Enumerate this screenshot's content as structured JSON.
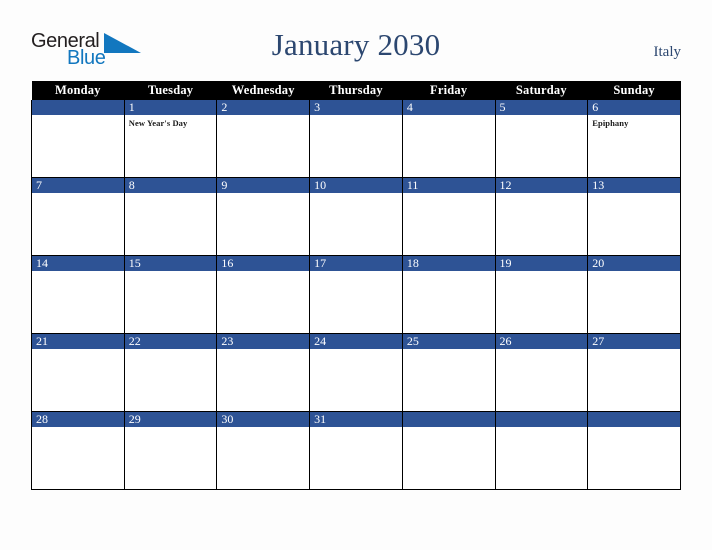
{
  "brand": {
    "name_part1": "General",
    "name_part2": "Blue",
    "triangle_icon": "blue-triangle-icon",
    "color_dark": "#231f20",
    "color_blue": "#1277bf"
  },
  "header": {
    "title": "January 2030",
    "locale": "Italy",
    "title_color": "#2c4770"
  },
  "calendar": {
    "month": "January",
    "year": "2030",
    "country": "Italy",
    "accent_color": "#2e5395",
    "header_background": "#000000",
    "weekday_headers": [
      "Monday",
      "Tuesday",
      "Wednesday",
      "Thursday",
      "Friday",
      "Saturday",
      "Sunday"
    ],
    "weeks": [
      [
        {
          "day": "",
          "event": ""
        },
        {
          "day": "1",
          "event": "New Year's Day"
        },
        {
          "day": "2",
          "event": ""
        },
        {
          "day": "3",
          "event": ""
        },
        {
          "day": "4",
          "event": ""
        },
        {
          "day": "5",
          "event": ""
        },
        {
          "day": "6",
          "event": "Epiphany"
        }
      ],
      [
        {
          "day": "7",
          "event": ""
        },
        {
          "day": "8",
          "event": ""
        },
        {
          "day": "9",
          "event": ""
        },
        {
          "day": "10",
          "event": ""
        },
        {
          "day": "11",
          "event": ""
        },
        {
          "day": "12",
          "event": ""
        },
        {
          "day": "13",
          "event": ""
        }
      ],
      [
        {
          "day": "14",
          "event": ""
        },
        {
          "day": "15",
          "event": ""
        },
        {
          "day": "16",
          "event": ""
        },
        {
          "day": "17",
          "event": ""
        },
        {
          "day": "18",
          "event": ""
        },
        {
          "day": "19",
          "event": ""
        },
        {
          "day": "20",
          "event": ""
        }
      ],
      [
        {
          "day": "21",
          "event": ""
        },
        {
          "day": "22",
          "event": ""
        },
        {
          "day": "23",
          "event": ""
        },
        {
          "day": "24",
          "event": ""
        },
        {
          "day": "25",
          "event": ""
        },
        {
          "day": "26",
          "event": ""
        },
        {
          "day": "27",
          "event": ""
        }
      ],
      [
        {
          "day": "28",
          "event": ""
        },
        {
          "day": "29",
          "event": ""
        },
        {
          "day": "30",
          "event": ""
        },
        {
          "day": "31",
          "event": ""
        },
        {
          "day": "",
          "event": ""
        },
        {
          "day": "",
          "event": ""
        },
        {
          "day": "",
          "event": ""
        }
      ]
    ]
  }
}
